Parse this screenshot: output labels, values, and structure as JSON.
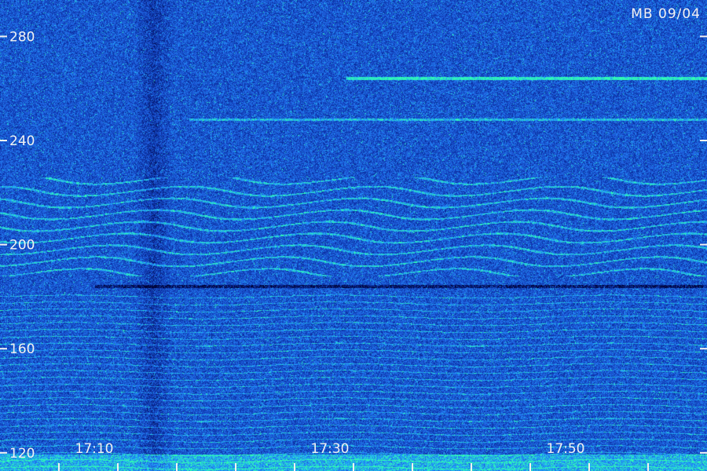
{
  "chart_data": {
    "type": "heatmap",
    "title": "MB 09/04",
    "xlabel": "",
    "ylabel": "",
    "y_ticks": [
      280,
      240,
      200,
      160,
      120
    ],
    "y_range": [
      113,
      294
    ],
    "x_ticks": [
      "17:10",
      "17:30",
      "17:50"
    ],
    "x_range_minutes": [
      "17:02",
      "18:02"
    ],
    "colormap": [
      "#000030",
      "#0a2ea0",
      "#2060e0",
      "#20a0ff",
      "#30ffb0"
    ],
    "features": {
      "bright_horizontal_line_at": 264,
      "band_at": 248,
      "dark_horizontal_line_at": 184,
      "dark_vertical_band_at": "17:15",
      "wavy_echo_range": [
        188,
        226
      ]
    },
    "grid": false,
    "legend": "none"
  }
}
